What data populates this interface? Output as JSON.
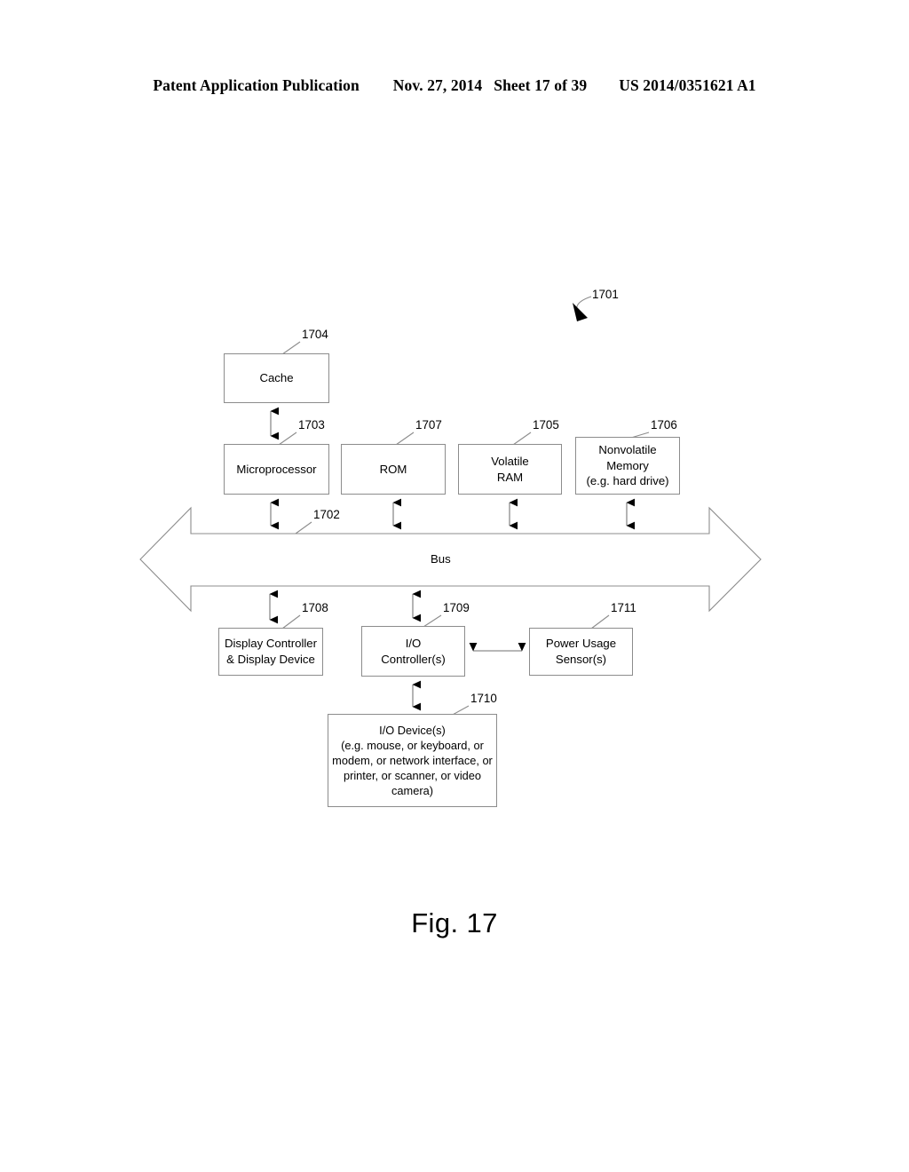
{
  "header": {
    "publication": "Patent Application Publication",
    "date": "Nov. 27, 2014",
    "sheet": "Sheet 17 of 39",
    "patent_number": "US 2014/0351621 A1"
  },
  "figure": {
    "caption": "Fig. 17",
    "system_ref": "1701"
  },
  "diagram": {
    "bus": {
      "label": "Bus",
      "ref": "1702"
    },
    "nodes": [
      {
        "id": "cache",
        "label": "Cache",
        "ref": "1704"
      },
      {
        "id": "micro",
        "label": "Microprocessor",
        "ref": "1703"
      },
      {
        "id": "rom",
        "label": "ROM",
        "ref": "1707"
      },
      {
        "id": "vram",
        "label": "Volatile\nRAM",
        "ref": "1705"
      },
      {
        "id": "nvmem",
        "label": "Nonvolatile\nMemory\n(e.g. hard drive)",
        "ref": "1706"
      },
      {
        "id": "display",
        "label": "Display Controller\n& Display Device",
        "ref": "1708"
      },
      {
        "id": "iocontroller",
        "label": "I/O\nController(s)",
        "ref": "1709"
      },
      {
        "id": "powersensor",
        "label": "Power Usage\nSensor(s)",
        "ref": "1711"
      },
      {
        "id": "iodevices",
        "label": "I/O Device(s)\n(e.g. mouse, or keyboard, or\nmodem, or network interface, or\nprinter, or scanner, or video\ncamera)",
        "ref": "1710"
      }
    ],
    "connections": [
      {
        "from": "cache",
        "to": "micro",
        "type": "bidirectional-vertical"
      },
      {
        "from": "micro",
        "to": "bus",
        "type": "bidirectional-vertical"
      },
      {
        "from": "rom",
        "to": "bus",
        "type": "bidirectional-vertical"
      },
      {
        "from": "vram",
        "to": "bus",
        "type": "bidirectional-vertical"
      },
      {
        "from": "nvmem",
        "to": "bus",
        "type": "bidirectional-vertical"
      },
      {
        "from": "bus",
        "to": "display",
        "type": "bidirectional-vertical"
      },
      {
        "from": "bus",
        "to": "iocontroller",
        "type": "bidirectional-vertical"
      },
      {
        "from": "iocontroller",
        "to": "powersensor",
        "type": "bidirectional-horizontal"
      },
      {
        "from": "iocontroller",
        "to": "iodevices",
        "type": "bidirectional-vertical"
      }
    ]
  },
  "colors": {
    "ink": "#000000",
    "line": "#8c8c8c",
    "paper": "#ffffff"
  }
}
